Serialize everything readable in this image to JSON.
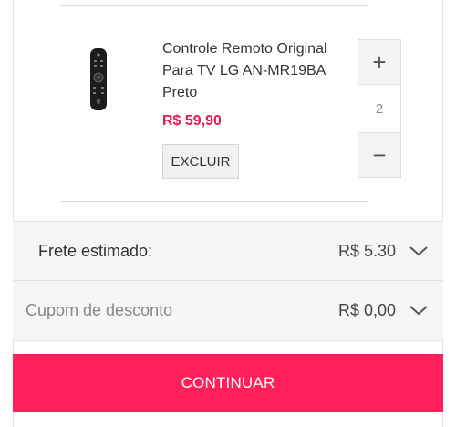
{
  "cart_item": {
    "product_name": "Controle Remoto Original Para TV LG AN-MR19BA Preto",
    "price": "R$ 59,90",
    "remove_label": "EXCLUIR",
    "quantity": "2",
    "image_icon": "tv-remote-image"
  },
  "stepper": {
    "plus_symbol": "+",
    "minus_symbol": "−"
  },
  "shipping": {
    "label": "Frete estimado:",
    "value": "R$ 5.30"
  },
  "coupon": {
    "label": "Cupom de desconto",
    "value": "R$ 0,00"
  },
  "continue_label": "CONTINUAR",
  "colors": {
    "accent": "#ff1f5a",
    "price": "#e8174f"
  }
}
